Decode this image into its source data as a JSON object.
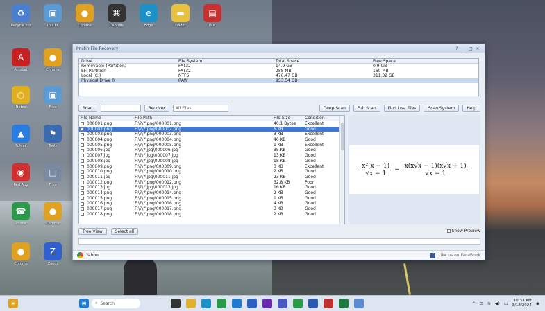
{
  "window": {
    "title": "Pristin File Recovery",
    "controls": [
      "?",
      "_",
      "□",
      "×"
    ]
  },
  "drives": {
    "headers": [
      "Drive",
      "File System",
      "Total Space",
      "Free Space"
    ],
    "rows": [
      [
        "Removable (Partition)",
        "FAT32",
        "14.9 GB",
        "0.9 GB"
      ],
      [
        "EFI Partition",
        "FAT32",
        "288 MB",
        "160 MB"
      ],
      [
        "Local (C:)",
        "NTFS",
        "476.47 GB",
        "311.32 GB"
      ],
      [
        "Physical Drive 0",
        "RAW",
        "953.54 GB",
        ""
      ]
    ],
    "selected_index": 3
  },
  "toolbar": {
    "scan_label": "Scan",
    "scan_field": "",
    "recover_label": "Recover",
    "filter_value": "All Files",
    "deep_scan_label": "Deep Scan",
    "full_scan_label": "Full Scan",
    "find_lost_label": "Find Lost files",
    "scan_system_label": "Scan System",
    "help_label": "Help"
  },
  "files": {
    "headers": [
      "File Name",
      "File Path",
      "File Size",
      "Condition"
    ],
    "rows": [
      [
        "000001.png",
        "F:\\?\\?\\png\\000001.png",
        "40.1 Bytes",
        "Excellent"
      ],
      [
        "000002.png",
        "F:\\?\\?\\png\\000002.png",
        "6 KB",
        "Good"
      ],
      [
        "000003.png",
        "F:\\?\\?\\png\\000003.png",
        "3 KB",
        "Excellent"
      ],
      [
        "000004.png",
        "F:\\?\\?\\png\\000004.png",
        "46 KB",
        "Good"
      ],
      [
        "000005.png",
        "F:\\?\\?\\png\\000005.png",
        "1 KB",
        "Excellent"
      ],
      [
        "000006.jpg",
        "F:\\?\\?\\jpg\\000006.jpg",
        "35 KB",
        "Good"
      ],
      [
        "000007.jpg",
        "F:\\?\\?\\jpg\\000007.jpg",
        "13 KB",
        "Good"
      ],
      [
        "000008.jpg",
        "F:\\?\\?\\jpg\\000008.jpg",
        "18 KB",
        "Good"
      ],
      [
        "000009.png",
        "F:\\?\\?\\png\\000009.png",
        "3 KB",
        "Excellent"
      ],
      [
        "000010.png",
        "F:\\?\\?\\png\\000010.png",
        "2 KB",
        "Good"
      ],
      [
        "000011.jpg",
        "F:\\?\\?\\jpg\\000011.jpg",
        "23 KB",
        "Good"
      ],
      [
        "000012.png",
        "F:\\?\\?\\png\\000012.png",
        "32.8 KB",
        "Poor"
      ],
      [
        "000013.jpg",
        "F:\\?\\?\\jpg\\000013.jpg",
        "16 KB",
        "Good"
      ],
      [
        "000014.png",
        "F:\\?\\?\\png\\000014.png",
        "2 KB",
        "Good"
      ],
      [
        "000015.png",
        "F:\\?\\?\\png\\000015.png",
        "1 KB",
        "Good"
      ],
      [
        "000016.png",
        "F:\\?\\?\\png\\000016.png",
        "4 KB",
        "Good"
      ],
      [
        "000017.png",
        "F:\\?\\?\\png\\000017.png",
        "3 KB",
        "Good"
      ],
      [
        "000018.png",
        "F:\\?\\?\\png\\000018.png",
        "2 KB",
        "Good"
      ]
    ],
    "selected_index": 1
  },
  "bottom": {
    "tree_view_label": "Tree View",
    "select_all_label": "Select all",
    "show_preview_label": "Show Preview"
  },
  "statusbar": {
    "left_text": "Yahoo",
    "right_text": "Like us on FaceBook"
  },
  "desktop_icons": [
    {
      "label": "Recycle Bin",
      "color": "#4a7fd0",
      "glyph": "♻"
    },
    {
      "label": "This PC",
      "color": "#5b9bd5",
      "glyph": "▣"
    },
    {
      "label": "Chrome",
      "color": "#e0a020",
      "glyph": "●"
    },
    {
      "label": "Capture",
      "color": "#333333",
      "glyph": "⌘"
    },
    {
      "label": "Edge",
      "color": "#1e90c8",
      "glyph": "e"
    },
    {
      "label": "Folder",
      "color": "#e8c040",
      "glyph": "▬"
    },
    {
      "label": "PDF",
      "color": "#c83030",
      "glyph": "▤"
    },
    {
      "label": "Acrobat",
      "color": "#c82020",
      "glyph": "A"
    },
    {
      "label": "Chrome",
      "color": "#e0a020",
      "glyph": "●"
    },
    {
      "label": "Notes",
      "color": "#e0b020",
      "glyph": "○"
    },
    {
      "label": "Files",
      "color": "#5b9bd5",
      "glyph": "▣"
    },
    {
      "label": "Folder",
      "color": "#2a7de0",
      "glyph": "▲"
    },
    {
      "label": "Tools",
      "color": "#3a6ab0",
      "glyph": "⚑"
    },
    {
      "label": "Red App",
      "color": "#d03030",
      "glyph": "◉"
    },
    {
      "label": "Files",
      "color": "#7a8aa0",
      "glyph": "□"
    },
    {
      "label": "Phone",
      "color": "#2a9a4a",
      "glyph": "☎"
    },
    {
      "label": "Chrome",
      "color": "#e0a020",
      "glyph": "●"
    },
    {
      "label": "Chrome",
      "color": "#e0a020",
      "glyph": "●"
    },
    {
      "label": "Zoom",
      "color": "#3060d0",
      "glyph": "Z"
    }
  ],
  "taskbar": {
    "search_placeholder": "Search",
    "time": "10:33 AM",
    "date": "3/18/2024",
    "icons": [
      {
        "name": "widgets",
        "color": "#e0a020"
      },
      {
        "name": "start",
        "color": "#1e78d0"
      },
      {
        "name": "taskview",
        "color": "#333333"
      },
      {
        "name": "explorer",
        "color": "#e0b030"
      },
      {
        "name": "edge",
        "color": "#1e90c8"
      },
      {
        "name": "chrome",
        "color": "#2a9a4a"
      },
      {
        "name": "store",
        "color": "#1e78d0"
      },
      {
        "name": "mail",
        "color": "#2a60c0"
      },
      {
        "name": "app",
        "color": "#6a2ab0"
      },
      {
        "name": "teams",
        "color": "#4a5ac0"
      },
      {
        "name": "whatsapp",
        "color": "#2a9a4a"
      },
      {
        "name": "word",
        "color": "#2a5ab0"
      },
      {
        "name": "chrome2",
        "color": "#c03030"
      },
      {
        "name": "excel",
        "color": "#1e7a40"
      },
      {
        "name": "app2",
        "color": "#5a8ad0"
      }
    ]
  }
}
